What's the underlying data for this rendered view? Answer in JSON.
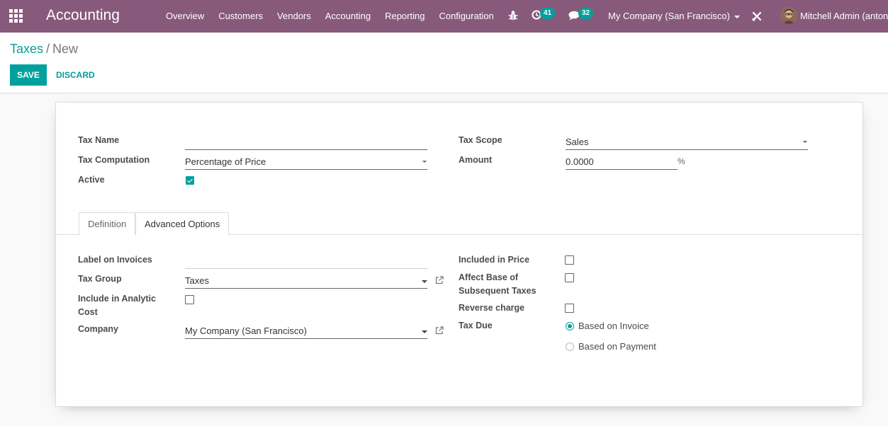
{
  "navbar": {
    "brand": "Accounting",
    "menu": [
      "Overview",
      "Customers",
      "Vendors",
      "Accounting",
      "Reporting",
      "Configuration"
    ],
    "activity_count": "41",
    "message_count": "32",
    "company": "My Company (San Francisco)",
    "user": "Mitchell Admin (anton",
    "icons": {
      "apps": "apps-grid-icon",
      "debug": "bug-icon",
      "activity": "clock-icon",
      "messages": "chat-icon",
      "tools": "tools-icon"
    }
  },
  "breadcrumb": {
    "parent": "Taxes",
    "separator": "/",
    "current": "New"
  },
  "actions": {
    "save": "SAVE",
    "discard": "DISCARD"
  },
  "form": {
    "tax_name": {
      "label": "Tax Name",
      "value": ""
    },
    "tax_computation": {
      "label": "Tax Computation",
      "value": "Percentage of Price"
    },
    "active": {
      "label": "Active",
      "checked": true
    },
    "tax_scope": {
      "label": "Tax Scope",
      "value": "Sales"
    },
    "amount": {
      "label": "Amount",
      "value": "0.0000",
      "unit": "%"
    }
  },
  "tabs": [
    {
      "label": "Definition",
      "active": false
    },
    {
      "label": "Advanced Options",
      "active": true
    }
  ],
  "advanced": {
    "label_on_invoices": {
      "label": "Label on Invoices",
      "value": ""
    },
    "tax_group": {
      "label": "Tax Group",
      "value": "Taxes"
    },
    "include_analytic": {
      "label_line1": "Include in Analytic",
      "label_line2": "Cost",
      "checked": false
    },
    "company": {
      "label": "Company",
      "value": "My Company (San Francisco)"
    },
    "included_in_price": {
      "label": "Included in Price",
      "checked": false
    },
    "affect_base": {
      "label_line1": "Affect Base of",
      "label_line2": "Subsequent Taxes",
      "checked": false
    },
    "reverse_charge": {
      "label": "Reverse charge",
      "checked": false
    },
    "tax_due": {
      "label": "Tax Due",
      "options": [
        {
          "label": "Based on Invoice",
          "selected": true
        },
        {
          "label": "Based on Payment",
          "selected": false
        }
      ]
    }
  },
  "colors": {
    "brand": "#875a7b",
    "accent": "#00a09d"
  }
}
